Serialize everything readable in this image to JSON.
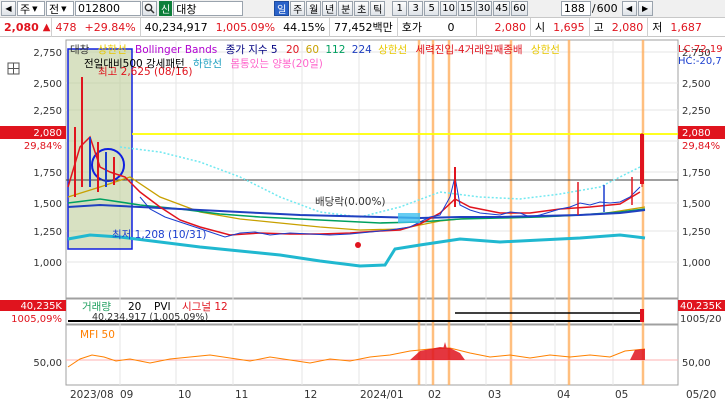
{
  "toolbar": {
    "left_arrow": "◀",
    "mode": "주",
    "dropdown_arrow": "▼",
    "kind": "전",
    "code": "012800",
    "search_icon": "magnifier-icon",
    "badge": "신",
    "name": "대창",
    "periods": [
      "일",
      "주",
      "월",
      "년",
      "분",
      "초",
      "틱"
    ],
    "nums": [
      "1",
      "3",
      "5",
      "10",
      "15",
      "30",
      "45",
      "60"
    ],
    "count": "188",
    "total": "600",
    "nav_left": "◀",
    "nav_right": "▶"
  },
  "quote": {
    "price": "2,080",
    "change": "478",
    "change_pct": "+29.84%",
    "volume": "40,234,917",
    "vol_ratio": "1,005.09%",
    "turnover": "44.15%",
    "amount": "77,452백만",
    "hoga_label": "호가",
    "hoga_val": "0",
    "hoga_price": "2,080",
    "open_label": "시",
    "open": "1,695",
    "high_label": "고",
    "high": "2,080",
    "low_label": "저",
    "low": "1,687"
  },
  "legend": {
    "line1": [
      {
        "text": "대창",
        "color": "#333333"
      },
      {
        "text": "상한선",
        "color": "#ffd400"
      },
      {
        "text": "Bollinger Bands",
        "color": "#b000d0"
      },
      {
        "text": "종가 지수 5",
        "color": "#000080"
      },
      {
        "text": "20",
        "color": "#e0141e"
      },
      {
        "text": "60",
        "color": "#c8a000"
      },
      {
        "text": "112",
        "color": "#00a060"
      },
      {
        "text": "224",
        "color": "#2040c0"
      },
      {
        "text": "상한선",
        "color": "#ffd400"
      },
      {
        "text": "세력진입-4거래일째종배",
        "color": "#e0141e"
      },
      {
        "text": "상한선",
        "color": "#ffd400"
      }
    ],
    "line2": [
      {
        "text": "전일대비500 강세패턴",
        "color": "#000000"
      },
      {
        "text": "하한선",
        "color": "#20a0c0"
      },
      {
        "text": "몸통있는 양봉(20일)",
        "color": "#ff66cc"
      }
    ],
    "lc_label": "LC:72,19",
    "hc_label": "HC:-20,7"
  },
  "chart": {
    "price_ticks": [
      "2,750",
      "2,500",
      "2,250",
      "2,000",
      "1,750",
      "1,500",
      "1,250",
      "1,000"
    ],
    "current_price": "2,080",
    "current_pct": "29,84%",
    "high_annotation": "최고 2,625 (08/16)",
    "low_annotation": "최저 1,208 (10/31)",
    "dividend_annotation": "배당락(0.00%)",
    "x_labels": [
      "2023/08",
      "09",
      "10",
      "11",
      "12",
      "2024/01",
      "02",
      "03",
      "04",
      "05",
      "05/20"
    ]
  },
  "volume_panel": {
    "title": "거래량",
    "p1": "20",
    "pvi": "PVI",
    "signal": "시그널 12",
    "left_val": "40,235K",
    "left_pct": "1005,09%",
    "info": "40,234,917 (1,005.09%)",
    "right_val": "40,235K",
    "right_pct": "1005/20"
  },
  "mfi_panel": {
    "title": "MFI 50",
    "tick": "50,00"
  },
  "colors": {
    "up": "#e0141e",
    "down": "#1a3ecf",
    "upper_band": "#ffff00",
    "cyan": "#20b8d0",
    "orange_vline": "#ffb060",
    "highlight_box": "#b8c890"
  }
}
